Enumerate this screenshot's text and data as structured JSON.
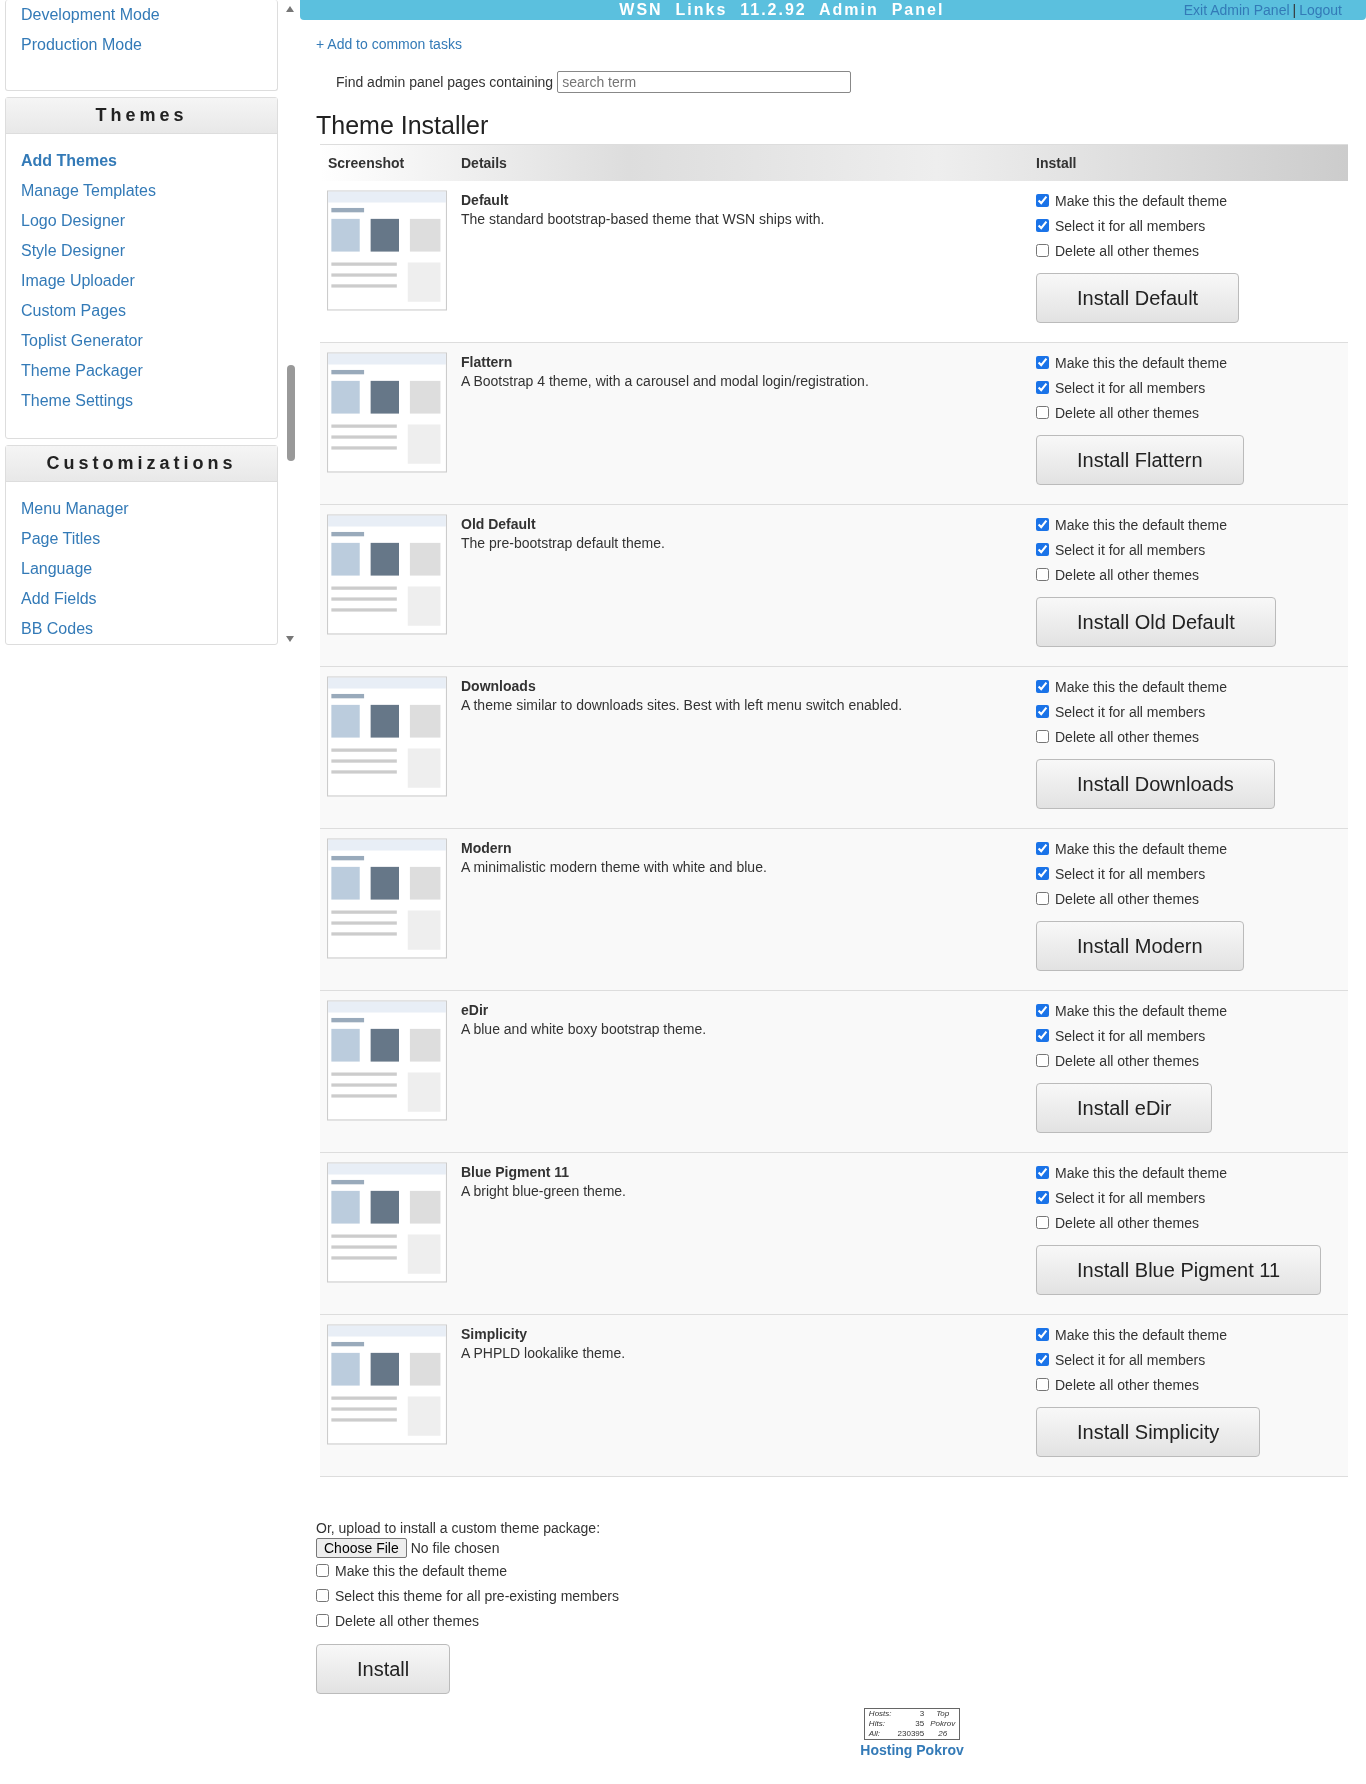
{
  "sidebar": {
    "top_items": [
      "Development Mode",
      "Production Mode"
    ],
    "sections": [
      {
        "title": "Themes",
        "items": [
          {
            "label": "Add Themes",
            "selected": true
          },
          {
            "label": "Manage Templates",
            "selected": false
          },
          {
            "label": "Logo Designer",
            "selected": false
          },
          {
            "label": "Style Designer",
            "selected": false
          },
          {
            "label": "Image Uploader",
            "selected": false
          },
          {
            "label": "Custom Pages",
            "selected": false
          },
          {
            "label": "Toplist Generator",
            "selected": false
          },
          {
            "label": "Theme Packager",
            "selected": false
          },
          {
            "label": "Theme Settings",
            "selected": false
          }
        ]
      },
      {
        "title": "Customizations",
        "items": [
          {
            "label": "Menu Manager",
            "selected": false
          },
          {
            "label": "Page Titles",
            "selected": false
          },
          {
            "label": "Language",
            "selected": false
          },
          {
            "label": "Add Fields",
            "selected": false
          },
          {
            "label": "BB Codes",
            "selected": false
          }
        ]
      }
    ]
  },
  "top_bar": {
    "title": "WSN  Links  11.2.92  Admin  Panel",
    "links": [
      "Exit Admin Panel",
      "Logout"
    ],
    "separator": "|"
  },
  "add_task": "+ Add to common tasks",
  "search": {
    "label": "Find admin panel pages containing",
    "placeholder": "search term"
  },
  "heading": "Theme Installer",
  "table": {
    "columns": [
      "Screenshot",
      "Details",
      "Install"
    ],
    "rows": [
      {
        "name": "Default",
        "description": "The standard bootstrap-based theme that WSN ships with.",
        "options": [
          {
            "label": "Make this the default theme",
            "checked": true
          },
          {
            "label": "Select it for all members",
            "checked": true
          },
          {
            "label": "Delete all other themes",
            "checked": false
          }
        ],
        "button": "Install Default"
      },
      {
        "name": "Flattern",
        "description": "A Bootstrap 4 theme, with a carousel and modal login/registration.",
        "options": [
          {
            "label": "Make this the default theme",
            "checked": true
          },
          {
            "label": "Select it for all members",
            "checked": true
          },
          {
            "label": "Delete all other themes",
            "checked": false
          }
        ],
        "button": "Install Flattern"
      },
      {
        "name": "Old Default",
        "description": "The pre-bootstrap default theme.",
        "options": [
          {
            "label": "Make this the default theme",
            "checked": true
          },
          {
            "label": "Select it for all members",
            "checked": true
          },
          {
            "label": "Delete all other themes",
            "checked": false
          }
        ],
        "button": "Install Old Default"
      },
      {
        "name": "Downloads",
        "description": "A theme similar to downloads sites. Best with left menu switch enabled.",
        "options": [
          {
            "label": "Make this the default theme",
            "checked": true
          },
          {
            "label": "Select it for all members",
            "checked": true
          },
          {
            "label": "Delete all other themes",
            "checked": false
          }
        ],
        "button": "Install Downloads"
      },
      {
        "name": "Modern",
        "description": "A minimalistic modern theme with white and blue.",
        "options": [
          {
            "label": "Make this the default theme",
            "checked": true
          },
          {
            "label": "Select it for all members",
            "checked": true
          },
          {
            "label": "Delete all other themes",
            "checked": false
          }
        ],
        "button": "Install Modern"
      },
      {
        "name": "eDir",
        "description": "A blue and white boxy bootstrap theme.",
        "options": [
          {
            "label": "Make this the default theme",
            "checked": true
          },
          {
            "label": "Select it for all members",
            "checked": true
          },
          {
            "label": "Delete all other themes",
            "checked": false
          }
        ],
        "button": "Install eDir"
      },
      {
        "name": "Blue Pigment 11",
        "description": "A bright blue-green theme.",
        "options": [
          {
            "label": "Make this the default theme",
            "checked": true
          },
          {
            "label": "Select it for all members",
            "checked": true
          },
          {
            "label": "Delete all other themes",
            "checked": false
          }
        ],
        "button": "Install Blue Pigment 11"
      },
      {
        "name": "Simplicity",
        "description": "A PHPLD lookalike theme.",
        "options": [
          {
            "label": "Make this the default theme",
            "checked": true
          },
          {
            "label": "Select it for all members",
            "checked": true
          },
          {
            "label": "Delete all other themes",
            "checked": false
          }
        ],
        "button": "Install Simplicity"
      }
    ]
  },
  "upload": {
    "label": "Or, upload to install a custom theme package:",
    "choose_button": "Choose File",
    "file_status": "No file chosen",
    "options": [
      {
        "label": "Make this the default theme",
        "checked": false
      },
      {
        "label": "Select this theme for all pre-existing members",
        "checked": false
      },
      {
        "label": "Delete all other themes",
        "checked": false
      }
    ],
    "button": "Install"
  },
  "counter": {
    "cells": [
      "Hosts:",
      "3",
      "Top",
      "Hits:",
      "35",
      "Pokrov",
      "All:",
      "230395",
      "26"
    ],
    "link": "Hosting Pokrov"
  }
}
